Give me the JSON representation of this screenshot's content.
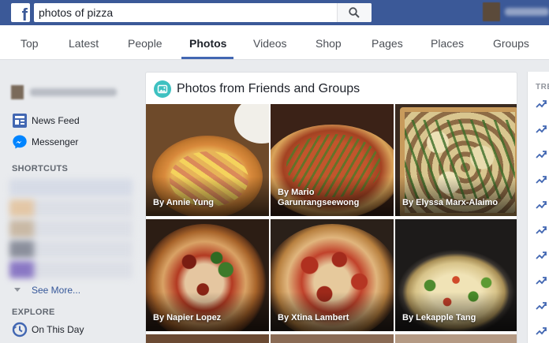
{
  "topbar": {
    "logo_letter": "f",
    "search_value": "photos of pizza",
    "search_icon": "magnifier-icon"
  },
  "tabs": [
    {
      "label": "Top",
      "active": false
    },
    {
      "label": "Latest",
      "active": false
    },
    {
      "label": "People",
      "active": false
    },
    {
      "label": "Photos",
      "active": true
    },
    {
      "label": "Videos",
      "active": false
    },
    {
      "label": "Shop",
      "active": false
    },
    {
      "label": "Pages",
      "active": false
    },
    {
      "label": "Places",
      "active": false
    },
    {
      "label": "Groups",
      "active": false
    }
  ],
  "leftnav": {
    "items": [
      {
        "label": "News Feed",
        "icon": "news-feed-icon"
      },
      {
        "label": "Messenger",
        "icon": "messenger-icon"
      }
    ],
    "shortcuts_label": "SHORTCUTS",
    "see_more": "See More...",
    "explore_label": "EXPLORE",
    "explore_items": [
      {
        "label": "On This Day",
        "icon": "on-this-day-icon"
      }
    ]
  },
  "results": {
    "section_title": "Photos from Friends and Groups",
    "section_icon": "photo-icon",
    "photos": [
      {
        "credit": "By Annie Yung"
      },
      {
        "credit": "By Mario Garunrangseewong"
      },
      {
        "credit": "By Elyssa Marx-Alaimo"
      },
      {
        "credit": "By Napier Lopez"
      },
      {
        "credit": "By Xtina Lambert"
      },
      {
        "credit": "By Lekapple Tang"
      }
    ]
  },
  "rightcol": {
    "label": "TRE",
    "trend_icon": "trending-arrow-icon"
  },
  "colors": {
    "brand_blue": "#3b5998",
    "link_blue": "#365899",
    "tab_underline": "#4267b2",
    "card_icon": "#3ec1c1"
  }
}
